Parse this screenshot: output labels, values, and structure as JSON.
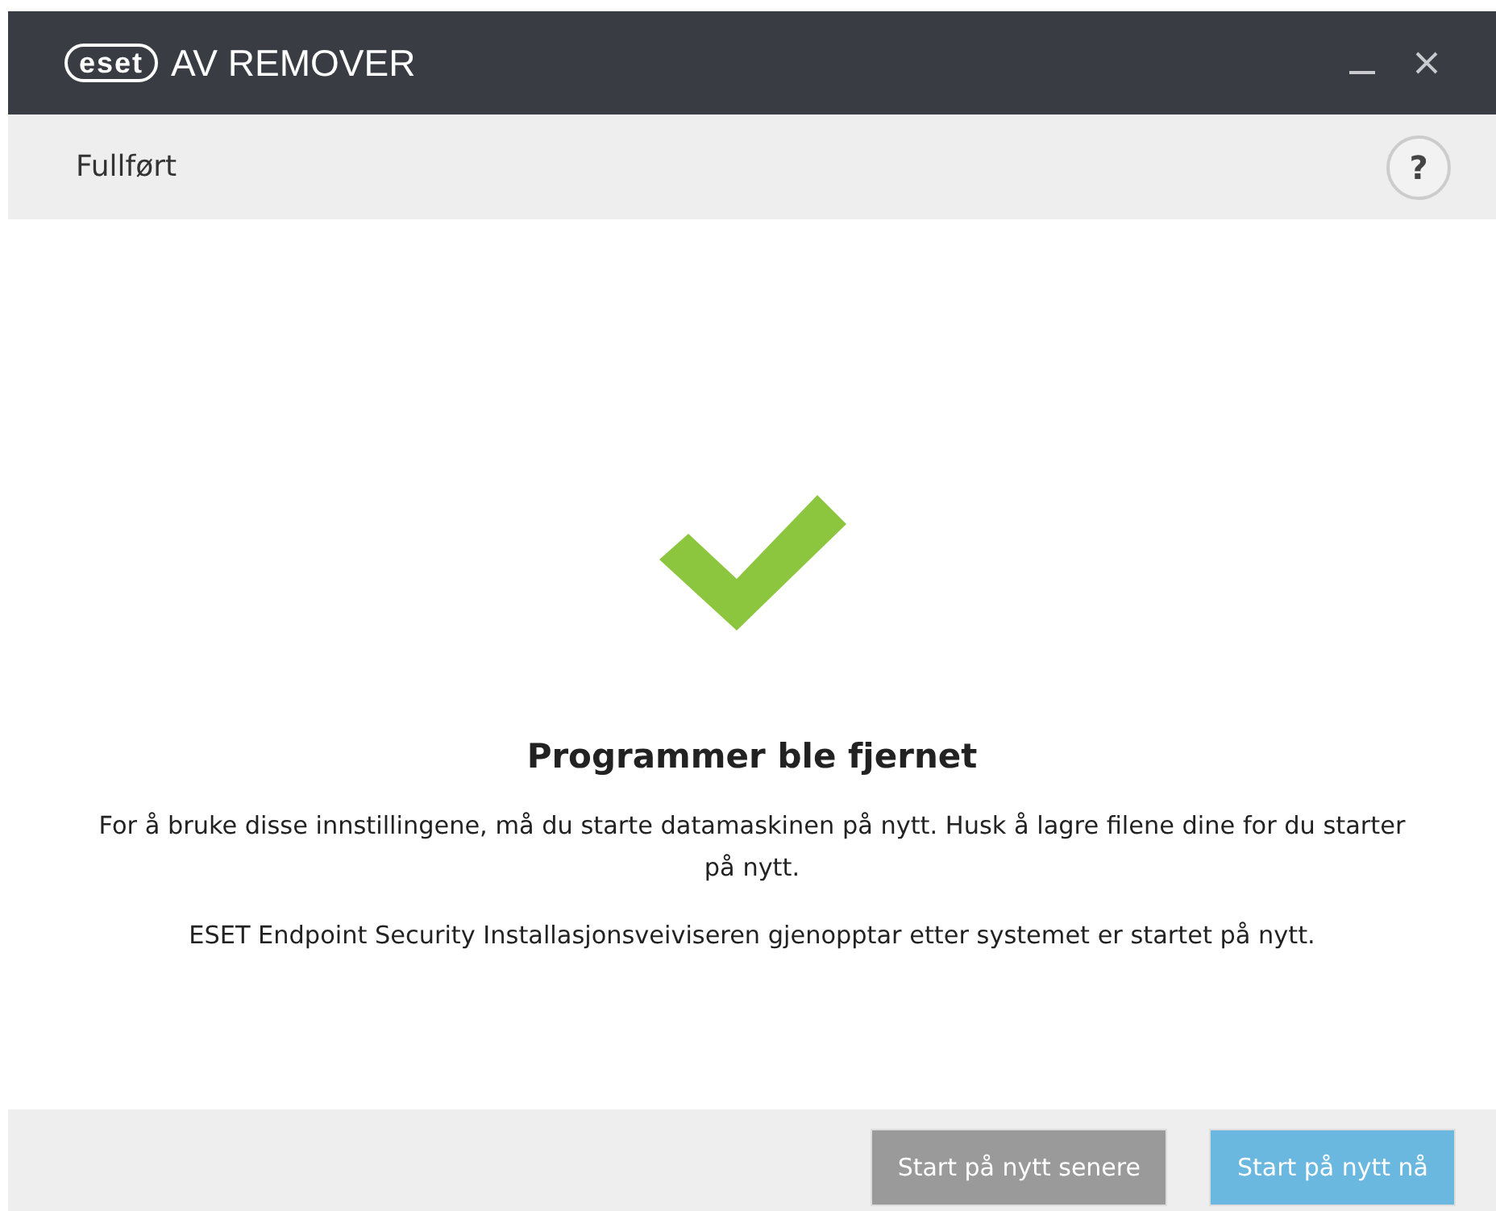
{
  "window": {
    "logo": "eset",
    "title": "AV REMOVER",
    "controls": [
      {
        "kind": "minimize"
      },
      {
        "kind": "close"
      }
    ]
  },
  "header": {
    "title": "Fullført",
    "help": "?"
  },
  "result": {
    "success": true,
    "title": "Programmer ble fjernet",
    "paragraphs": [
      "For å bruke disse innstillingene, må du starte datamaskinen på nytt. Husk å lagre filene dine for du starter på nytt.",
      "ESET Endpoint Security Installasjonsveiviseren gjenopptar etter systemet er startet på nytt."
    ]
  },
  "buttons": [
    {
      "label": "Start på nytt senere",
      "kind": "secondary"
    },
    {
      "label": "Start på nytt nå",
      "kind": "primary"
    }
  ]
}
